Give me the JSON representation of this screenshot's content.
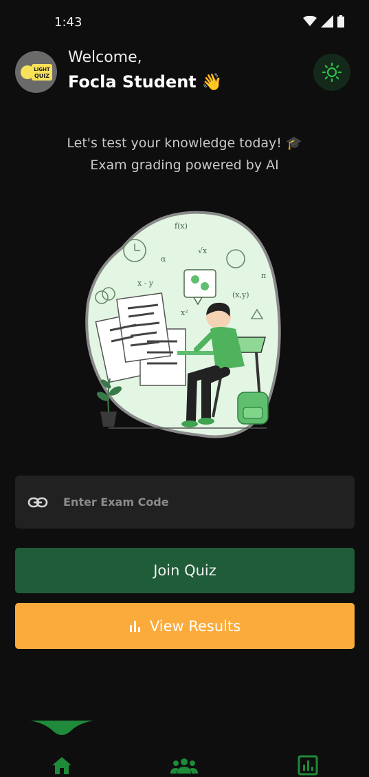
{
  "status_bar": {
    "time": "1:43",
    "icons": [
      "wifi-icon",
      "signal-icon",
      "battery-icon"
    ]
  },
  "header": {
    "welcome": "Welcome,",
    "user_name": "Focla Student",
    "wave_emoji": "👋",
    "avatar_text": "LIGHT QUIZ",
    "theme_icon": "sun-icon"
  },
  "tagline": {
    "line1": "Let's test your knowledge today! 🎓",
    "line2": "Exam grading powered by AI"
  },
  "exam_code": {
    "placeholder": "Enter Exam Code",
    "value": "",
    "icon": "link-icon"
  },
  "buttons": {
    "join": "Join Quiz",
    "results": "View Results"
  },
  "bottom_nav": {
    "items": [
      "home-icon",
      "groups-icon",
      "bar-chart-icon"
    ],
    "active": "home-icon"
  },
  "colors": {
    "background": "#0e0e0e",
    "primary_green": "#1f5c38",
    "accent_green": "#22a84a",
    "orange": "#fbab3c",
    "input_bg": "#212121",
    "illustration_bg": "#e3f5e3"
  }
}
